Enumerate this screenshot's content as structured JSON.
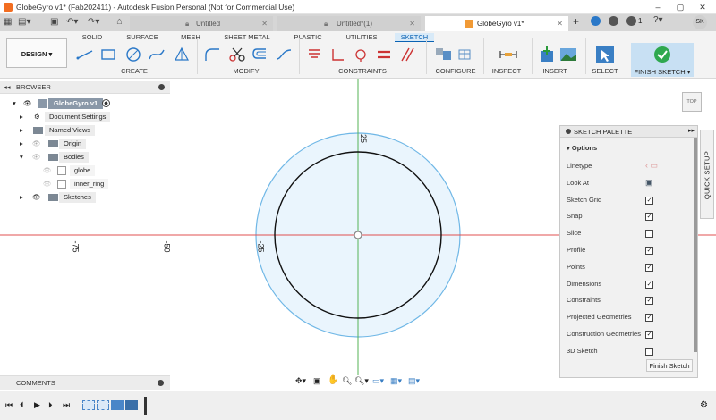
{
  "window": {
    "title": "GlobeGyro v1* (Fab202411) - Autodesk Fusion Personal (Not for Commercial Use)"
  },
  "tabs": [
    {
      "label": "Untitled",
      "active": false
    },
    {
      "label": "Untitled*(1)",
      "active": false
    },
    {
      "label": "GlobeGyro v1*",
      "active": true
    }
  ],
  "user": {
    "initials": "SK",
    "notifications": "1"
  },
  "ribbon": {
    "workspace": "DESIGN",
    "tabs": [
      "SOLID",
      "SURFACE",
      "MESH",
      "SHEET METAL",
      "PLASTIC",
      "UTILITIES",
      "SKETCH"
    ],
    "groups": {
      "create": "CREATE",
      "modify": "MODIFY",
      "constraints": "CONSTRAINTS",
      "configure": "CONFIGURE",
      "inspect": "INSPECT",
      "insert": "INSERT",
      "select": "SELECT",
      "finish": "FINISH SKETCH"
    }
  },
  "browser": {
    "title": "BROWSER",
    "root": "GlobeGyro v1",
    "items": [
      "Document Settings",
      "Named Views",
      "Origin",
      "Bodies",
      "globe",
      "inner_ring",
      "Sketches"
    ]
  },
  "canvas": {
    "labels": [
      "-75",
      "-50",
      "-25",
      "25"
    ],
    "view_cube": "TOP"
  },
  "palette": {
    "title": "SKETCH PALETTE",
    "section": "Options",
    "rows": [
      {
        "label": "Linetype",
        "type": "icons"
      },
      {
        "label": "Look At",
        "type": "icon"
      },
      {
        "label": "Sketch Grid",
        "checked": true
      },
      {
        "label": "Snap",
        "checked": true
      },
      {
        "label": "Slice",
        "checked": false
      },
      {
        "label": "Profile",
        "checked": true
      },
      {
        "label": "Points",
        "checked": true
      },
      {
        "label": "Dimensions",
        "checked": true
      },
      {
        "label": "Constraints",
        "checked": true
      },
      {
        "label": "Projected Geometries",
        "checked": true
      },
      {
        "label": "Construction Geometries",
        "checked": true
      },
      {
        "label": "3D Sketch",
        "checked": false
      }
    ],
    "finish_button": "Finish Sketch"
  },
  "quick_setup": "QUICK SETUP",
  "comments": {
    "title": "COMMENTS"
  },
  "colors": {
    "accent": "#0a62b3",
    "axis_red": "#e05050",
    "axis_green": "#56b356",
    "circle_outer": "#6fb7e6",
    "circle_fill": "#eaf5fd"
  }
}
